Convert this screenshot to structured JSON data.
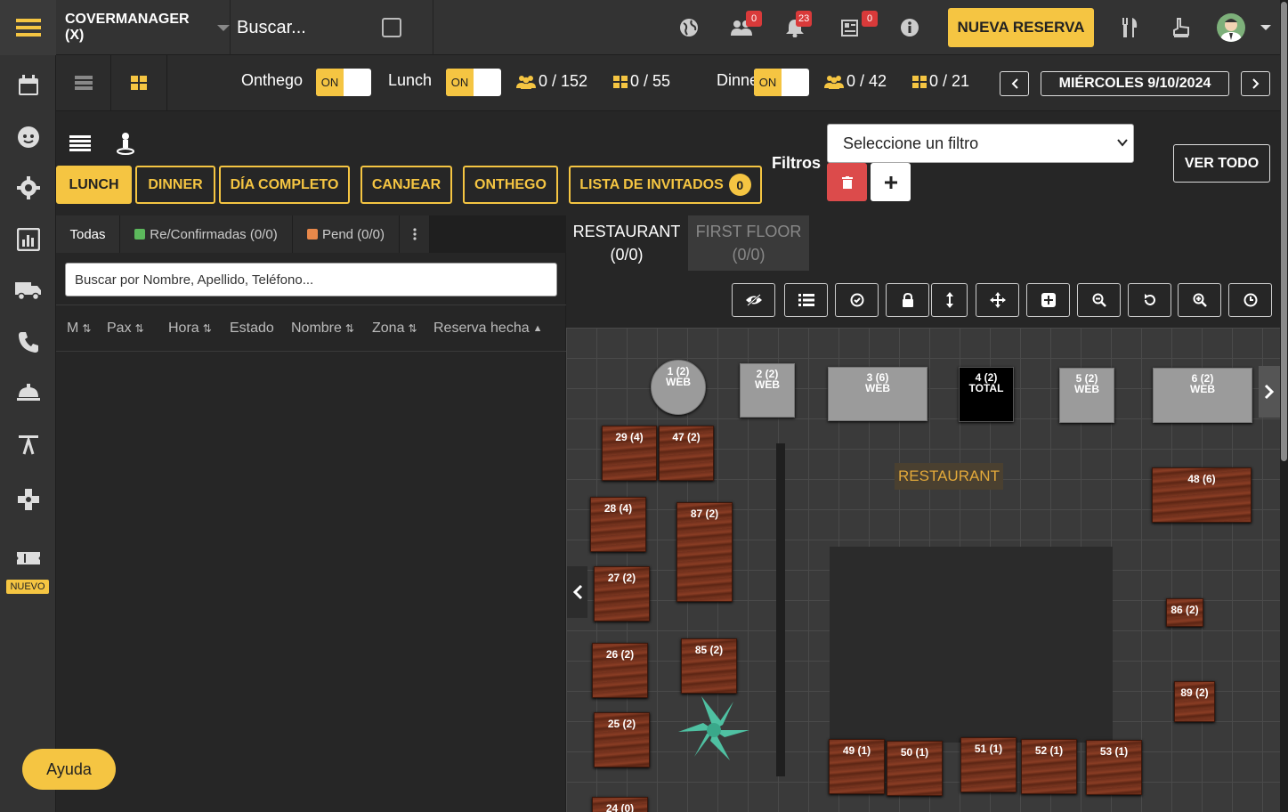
{
  "app": {
    "brand": "COVERMANAGER (X)",
    "search_placeholder": "Buscar...",
    "new_reservation": "NUEVA RESERVA",
    "help": "Ayuda",
    "nuevo_badge": "NUEVO",
    "accent": "#f5c542",
    "badges": {
      "guests": "0",
      "notifications": "23",
      "messages": "0"
    }
  },
  "shifts": {
    "onthego": {
      "label": "Onthego",
      "toggle": "ON"
    },
    "lunch": {
      "label": "Lunch",
      "toggle": "ON",
      "pax": "0 / 152",
      "tables": "0 / 55"
    },
    "dinner": {
      "label": "Dinner",
      "toggle": "ON",
      "pax": "0 / 42",
      "tables": "0 / 21"
    },
    "date": "MIÉRCOLES 9/10/2024"
  },
  "filters": {
    "tabs": [
      "LUNCH",
      "DINNER",
      "DÍA COMPLETO",
      "CANJEAR",
      "ONTHEGO",
      "LISTA DE INVITADOS"
    ],
    "guest_count": "0",
    "label": "Filtros",
    "select_value": "Seleccione un filtro",
    "view_all": "VER TODO"
  },
  "list": {
    "tabs": [
      "Todas",
      "Re/Confirmadas (0/0)",
      "Pend (0/0)"
    ],
    "search_placeholder": "Buscar por Nombre, Apellido, Teléfono...",
    "columns": [
      "M",
      "Pax",
      "Hora",
      "Estado",
      "Nombre",
      "Zona",
      "Reserva hecha"
    ]
  },
  "floor": {
    "tabs": [
      {
        "name": "RESTAURANT",
        "count": "(0/0)"
      },
      {
        "name": "FIRST FLOOR",
        "count": "(0/0)"
      }
    ],
    "zone_label": "RESTAURANT",
    "tables": [
      {
        "label": "1 (2)",
        "sub": "WEB"
      },
      {
        "label": "2 (2)",
        "sub": "WEB"
      },
      {
        "label": "3 (6)",
        "sub": "WEB"
      },
      {
        "label": "4 (2)",
        "sub": "TOTAL"
      },
      {
        "label": "5 (2)",
        "sub": "WEB"
      },
      {
        "label": "6 (2)",
        "sub": "WEB"
      },
      {
        "label": "29 (4)"
      },
      {
        "label": "47 (2)"
      },
      {
        "label": "48 (6)"
      },
      {
        "label": "28 (4)"
      },
      {
        "label": "87 (2)"
      },
      {
        "label": "27 (2)"
      },
      {
        "label": "86 (2)"
      },
      {
        "label": "26 (2)"
      },
      {
        "label": "85 (2)"
      },
      {
        "label": "89 (2)"
      },
      {
        "label": "25 (2)"
      },
      {
        "label": "49 (1)"
      },
      {
        "label": "50 (1)"
      },
      {
        "label": "51 (1)"
      },
      {
        "label": "52 (1)"
      },
      {
        "label": "53 (1)"
      },
      {
        "label": "24 (0)"
      }
    ]
  }
}
